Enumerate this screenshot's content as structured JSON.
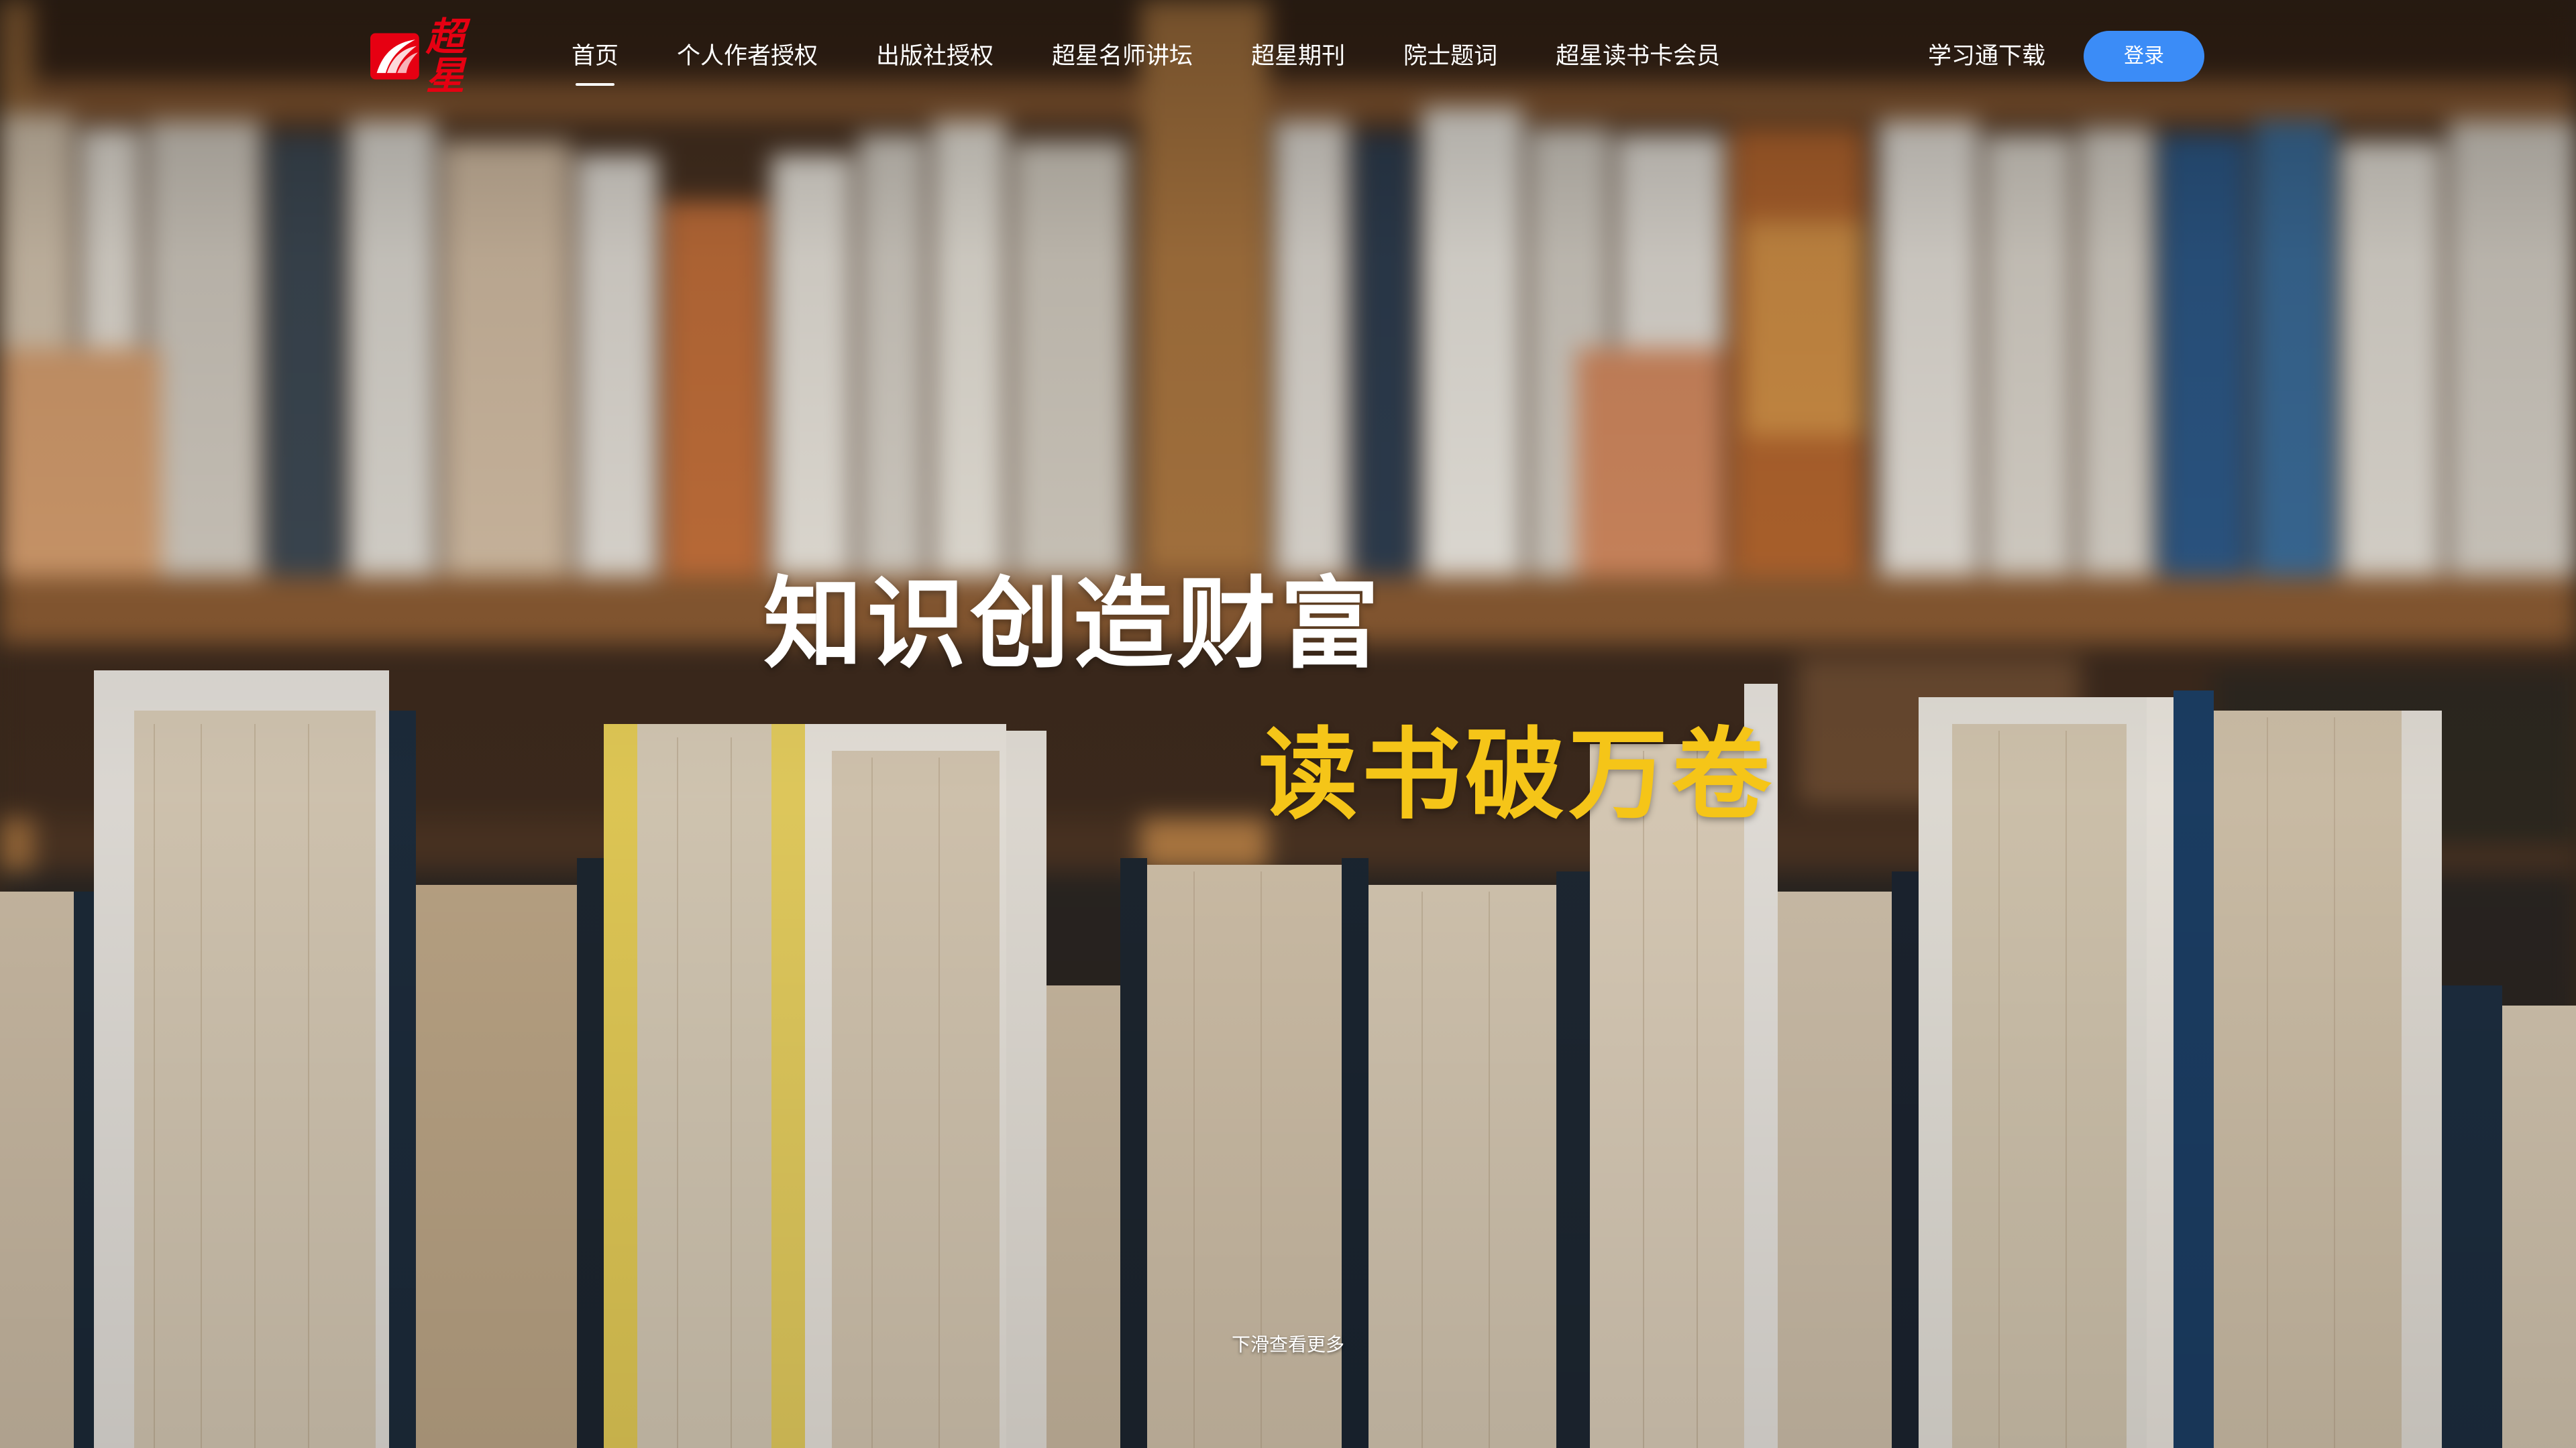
{
  "nav": {
    "logo_text": "超星",
    "items": [
      {
        "label": "首页",
        "active": true
      },
      {
        "label": "个人作者授权",
        "active": false
      },
      {
        "label": "出版社授权",
        "active": false
      },
      {
        "label": "超星名师讲坛",
        "active": false
      },
      {
        "label": "超星期刊",
        "active": false
      },
      {
        "label": "院士题词",
        "active": false
      },
      {
        "label": "超星读书卡会员",
        "active": false
      }
    ],
    "download_label": "学习通下载",
    "login_label": "登录"
  },
  "hero": {
    "headline": "知识创造财富",
    "subline": "读书破万卷",
    "scroll_hint": "下滑查看更多",
    "background": "blurred-bookshelf-photo"
  },
  "colors": {
    "brand_red": "#e60012",
    "login_blue": "#3b8cf7",
    "subline_yellow": "#f5c518",
    "text_white": "#ffffff"
  }
}
